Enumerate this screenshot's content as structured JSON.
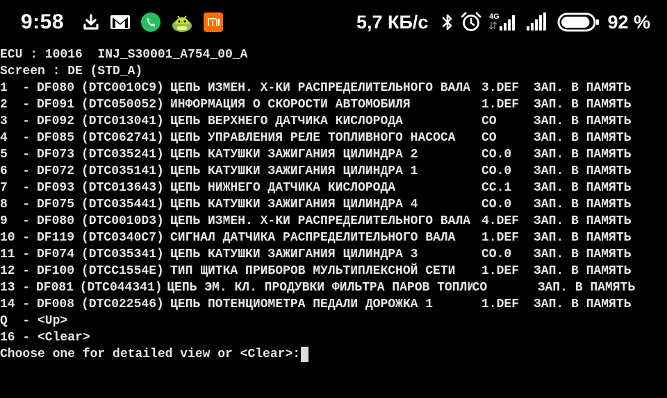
{
  "status_bar": {
    "time": "9:58",
    "notification_icons": [
      "download-icon",
      "gmail-icon",
      "whatsapp-icon",
      "android-app-icon",
      "mi-icon"
    ],
    "net_speed": "5,7 КБ/с",
    "network_type": "4G",
    "battery_percent": "92 %",
    "battery_level": 0.92
  },
  "terminal": {
    "ecu_line": "ECU : 10016  INJ_S30001_A754_00_A",
    "screen_line": "Screen : DE (STD_A)",
    "codes": [
      {
        "idx": "1  -",
        "df": "DF080",
        "dtc": "(DTC0010C9)",
        "desc": "ЦЕПЬ ИЗМЕН. Х-КИ РАСПРЕДЕЛИТЕЛЬНОГО ВАЛА",
        "status": "3.DEF",
        "memory": "ЗАП. В ПАМЯТЬ"
      },
      {
        "idx": "2  -",
        "df": "DF091",
        "dtc": "(DTC050052)",
        "desc": "ИНФОРМАЦИЯ О СКОРОСТИ АВТОМОБИЛЯ",
        "status": "1.DEF",
        "memory": "ЗАП. В ПАМЯТЬ"
      },
      {
        "idx": "3  -",
        "df": "DF092",
        "dtc": "(DTC013041)",
        "desc": "ЦЕПЬ ВЕРХНЕГО ДАТЧИКА КИСЛОРОДА",
        "status": "CO",
        "memory": "ЗАП. В ПАМЯТЬ"
      },
      {
        "idx": "4  -",
        "df": "DF085",
        "dtc": "(DTC062741)",
        "desc": "ЦЕПЬ УПРАВЛЕНИЯ РЕЛЕ ТОПЛИВНОГО НАСОСА",
        "status": "CO",
        "memory": "ЗАП. В ПАМЯТЬ"
      },
      {
        "idx": "5  -",
        "df": "DF073",
        "dtc": "(DTC035241)",
        "desc": "ЦЕПЬ КАТУШКИ ЗАЖИГАНИЯ ЦИЛИНДРА 2",
        "status": "CO.0",
        "memory": "ЗАП. В ПАМЯТЬ"
      },
      {
        "idx": "6  -",
        "df": "DF072",
        "dtc": "(DTC035141)",
        "desc": "ЦЕПЬ КАТУШКИ ЗАЖИГАНИЯ ЦИЛИНДРА 1",
        "status": "CO.0",
        "memory": "ЗАП. В ПАМЯТЬ"
      },
      {
        "idx": "7  -",
        "df": "DF093",
        "dtc": "(DTC013643)",
        "desc": "ЦЕПЬ НИЖНЕГО ДАТЧИКА КИСЛОРОДА",
        "status": "CC.1",
        "memory": "ЗАП. В ПАМЯТЬ"
      },
      {
        "idx": "8  -",
        "df": "DF075",
        "dtc": "(DTC035441)",
        "desc": "ЦЕПЬ КАТУШКИ ЗАЖИГАНИЯ ЦИЛИНДРА 4",
        "status": "CO.0",
        "memory": "ЗАП. В ПАМЯТЬ"
      },
      {
        "idx": "9  -",
        "df": "DF080",
        "dtc": "(DTC0010D3)",
        "desc": "ЦЕПЬ ИЗМЕН. Х-КИ РАСПРЕДЕЛИТЕЛЬНОГО ВАЛА",
        "status": "4.DEF",
        "memory": "ЗАП. В ПАМЯТЬ"
      },
      {
        "idx": "10 -",
        "df": "DF119",
        "dtc": "(DTC0340C7)",
        "desc": "СИГНАЛ ДАТЧИКА РАСПРЕДЕЛИТЕЛЬНОГО ВАЛА",
        "status": "1.DEF",
        "memory": "ЗАП. В ПАМЯТЬ"
      },
      {
        "idx": "11 -",
        "df": "DF074",
        "dtc": "(DTC035341)",
        "desc": "ЦЕПЬ КАТУШКИ ЗАЖИГАНИЯ ЦИЛИНДРА 3",
        "status": "CO.0",
        "memory": "ЗАП. В ПАМЯТЬ"
      },
      {
        "idx": "12 -",
        "df": "DF100",
        "dtc": "(DTCC1554E)",
        "desc": "ТИП ЩИТКА ПРИБОРОВ МУЛЬТИПЛЕКСНОЙ СЕТИ",
        "status": "1.DEF",
        "memory": "ЗАП. В ПАМЯТЬ"
      },
      {
        "idx": "13 -",
        "df": "DF081",
        "dtc": "(DTC044341)",
        "desc": "ЦЕПЬ ЭМ. КЛ. ПРОДУВКИ ФИЛЬТРА ПАРОВ ТОПЛИВА",
        "status": "CO",
        "memory": "ЗАП. В ПАМЯТЬ"
      },
      {
        "idx": "14 -",
        "df": "DF008",
        "dtc": "(DTC022546)",
        "desc": "ЦЕПЬ ПОТЕНЦИОМЕТРА ПЕДАЛИ ДОРОЖКА 1",
        "status": "1.DEF",
        "memory": "ЗАП. В ПАМЯТЬ"
      }
    ],
    "up_option": "Q  - <Up>",
    "clear_option": "16 - <Clear>",
    "prompt": "Choose one for detailed view or <Clear>:"
  }
}
